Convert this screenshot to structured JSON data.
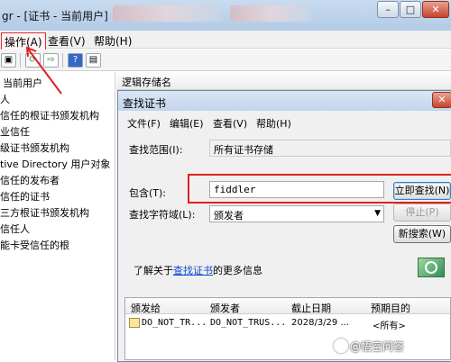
{
  "window": {
    "title": "gr - [证书 - 当前用户]",
    "buttons": {
      "minimize": "–",
      "maximize": "□",
      "close": "✕"
    }
  },
  "menubar": {
    "action": "操作(A)",
    "view": "查看(V)",
    "help": "帮助(H)"
  },
  "toolbar": {
    "icons": [
      "console-icon",
      "refresh-icon",
      "export-icon",
      "help-icon",
      "view-icon"
    ]
  },
  "tree": {
    "root": "当前用户",
    "items": [
      "人",
      "信任的根证书颁发机构",
      "业信任",
      "级证书颁发机构",
      "tive Directory 用户对象",
      "信任的发布者",
      "信任的证书",
      "三方根证书颁发机构",
      "信任人",
      "能卡受信任的根"
    ]
  },
  "right_pane": {
    "column_header": "逻辑存储名"
  },
  "dialog": {
    "title": "查找证书",
    "close": "✕",
    "menu": {
      "file": "文件(F)",
      "edit": "编辑(E)",
      "view": "查看(V)",
      "help": "帮助(H)"
    },
    "scope_label": "查找范围(I):",
    "scope_value": "所有证书存储",
    "contains_label": "包含(T):",
    "contains_value": "fiddler",
    "field_label": "查找字符域(L):",
    "field_value": "颁发者",
    "find_now": "立即查找(N)",
    "stop": "停止(P)",
    "new_search": "新搜索(W)",
    "info_prefix": "了解关于",
    "info_link": "查找证书",
    "info_suffix": "的更多信息"
  },
  "results": {
    "columns": [
      "颁发给",
      "颁发者",
      "截止日期",
      "预期目的"
    ],
    "rows": [
      {
        "issued_to": "DO_NOT_TR...",
        "issuer": "DO_NOT_TRUS...",
        "expiry": "2028/3/29 ...",
        "purpose": "<所有>"
      }
    ]
  },
  "watermark": "@悟空问答",
  "colors": {
    "annotation": "#e02020",
    "link": "#0a4bcc",
    "titlebar": "#c2d5ec"
  }
}
